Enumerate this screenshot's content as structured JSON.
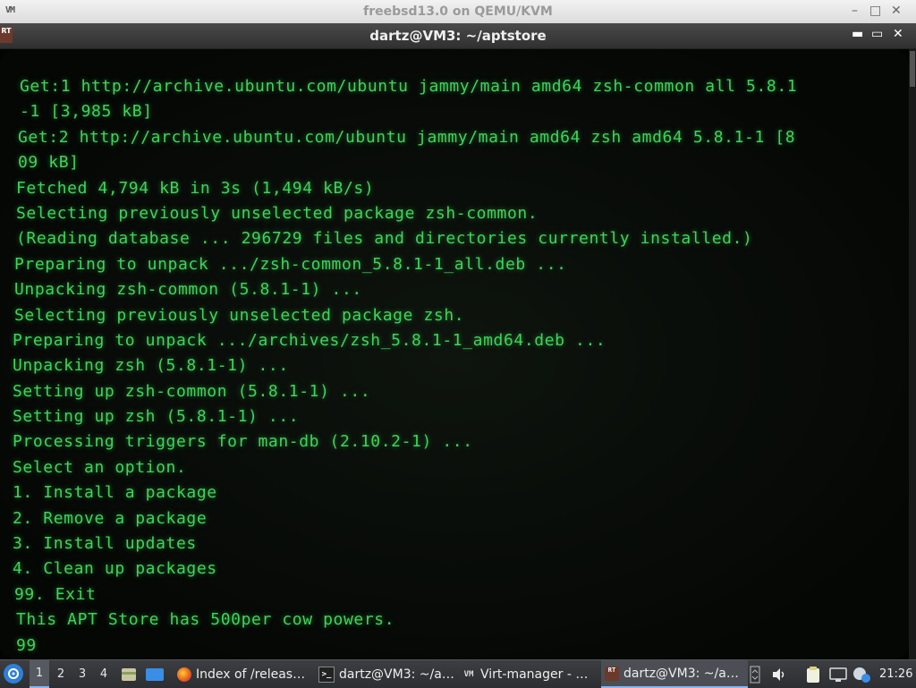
{
  "outer_window": {
    "title": "freebsd13.0 on QEMU/KVM",
    "logo_text": "VM",
    "controls": [
      "–",
      "□",
      "✕"
    ]
  },
  "terminal_window": {
    "app_icon_text": "RT",
    "title": "dartz@VM3: ~/aptstore",
    "controls": [
      "▬",
      "▭",
      "✕"
    ]
  },
  "terminal": {
    "lines": [
      "Get:1 http://archive.ubuntu.com/ubuntu jammy/main amd64 zsh-common all 5.8.1",
      "-1 [3,985 kB]",
      "Get:2 http://archive.ubuntu.com/ubuntu jammy/main amd64 zsh amd64 5.8.1-1 [8",
      "09 kB]",
      "Fetched 4,794 kB in 3s (1,494 kB/s)",
      "Selecting previously unselected package zsh-common.",
      "(Reading database ... 296729 files and directories currently installed.)",
      "Preparing to unpack .../zsh-common_5.8.1-1_all.deb ...",
      "Unpacking zsh-common (5.8.1-1) ...",
      "Selecting previously unselected package zsh.",
      "Preparing to unpack .../archives/zsh_5.8.1-1_amd64.deb ...",
      "Unpacking zsh (5.8.1-1) ...",
      "Setting up zsh-common (5.8.1-1) ...",
      "Setting up zsh (5.8.1-1) ...",
      "Processing triggers for man-db (2.10.2-1) ...",
      "Select an option.",
      "1. Install a package",
      "2. Remove a package",
      "3. Install updates",
      "4. Clean up packages",
      "99. Exit",
      "This APT Store has 500per cow powers.",
      "99"
    ],
    "text_color": "#3fd35a"
  },
  "taskbar": {
    "start_icon": "start-menu-icon",
    "workspaces": [
      "1",
      "2",
      "3",
      "4"
    ],
    "active_workspace": "1",
    "tasks": [
      {
        "icon": "firefox-icon",
        "label": "Index of /releas…"
      },
      {
        "icon": "terminal-icon",
        "label": "dartz@VM3: ~/a…"
      },
      {
        "icon": "virt-manager-icon",
        "label": "Virt-manager - …"
      },
      {
        "icon": "terminal-app-icon",
        "label": "dartz@VM3: ~/a…"
      }
    ],
    "clock": "21:26"
  }
}
